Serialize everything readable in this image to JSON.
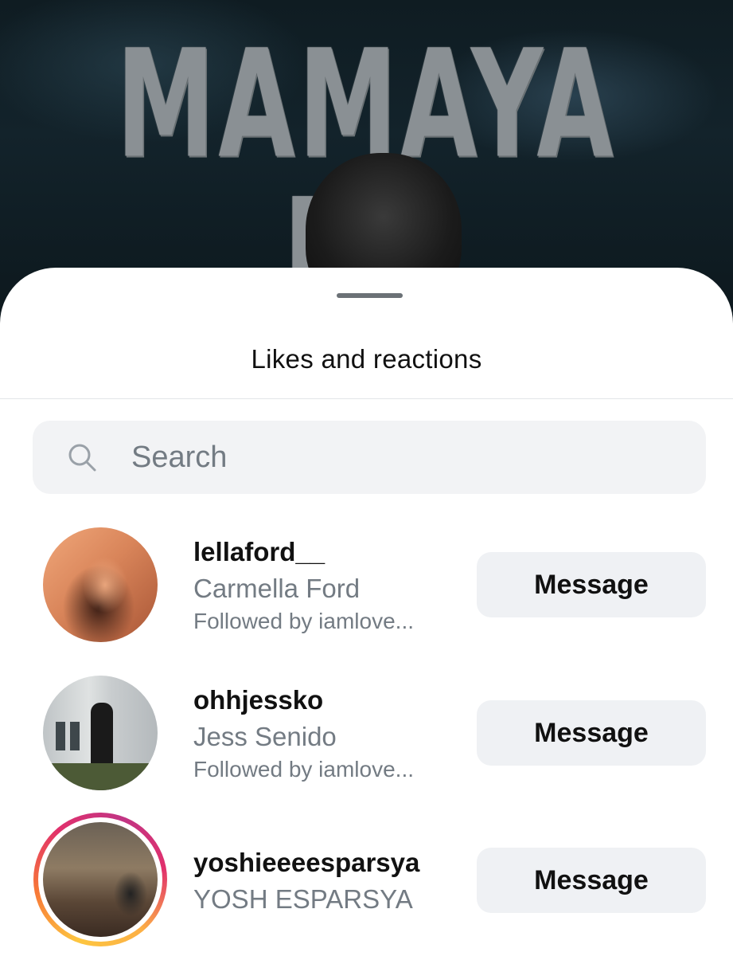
{
  "post": {
    "title": "MAMAYA NA"
  },
  "sheet": {
    "title": "Likes and reactions",
    "search_placeholder": "Search"
  },
  "users": [
    {
      "username": "lellaford__",
      "full_name": "Carmella Ford",
      "followed_by": "Followed by iamlove...",
      "action": "Message",
      "has_story": false
    },
    {
      "username": "ohhjessko",
      "full_name": "Jess Senido",
      "followed_by": "Followed by iamlove...",
      "action": "Message",
      "has_story": false
    },
    {
      "username": "yoshieeeesparsya",
      "full_name": "YOSH ESPARSYA",
      "followed_by": "",
      "action": "Message",
      "has_story": true
    }
  ],
  "colors": {
    "secondary_text": "#737b83",
    "button_bg": "#eff1f4",
    "search_bg": "#f2f3f5"
  }
}
